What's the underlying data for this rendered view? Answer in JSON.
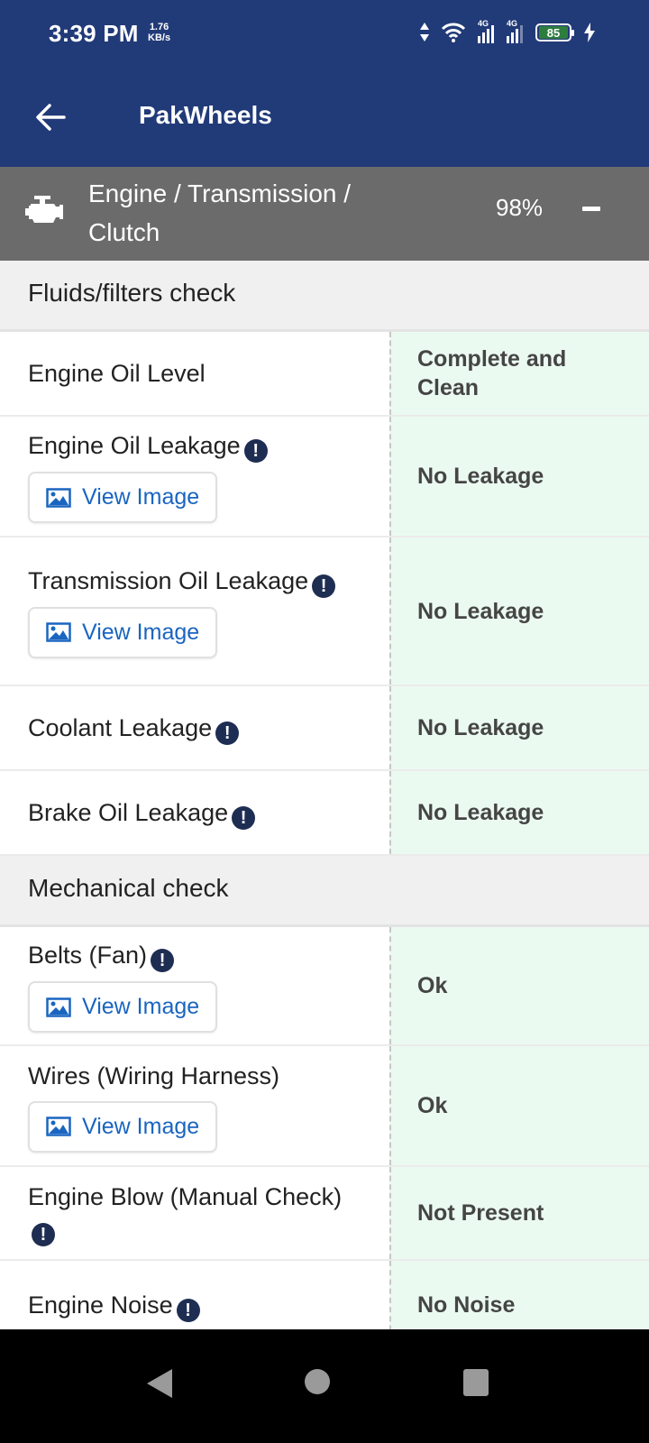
{
  "status_bar": {
    "time": "3:39 PM",
    "net_speed_value": "1.76",
    "net_speed_unit": "KB/s",
    "signal_1_label": "4G",
    "signal_2_label": "4G",
    "battery": "85",
    "icons": [
      "data-arrows-icon",
      "wifi-icon",
      "signal-icon",
      "signal-icon",
      "battery-icon",
      "charging-icon"
    ]
  },
  "app_bar": {
    "title": "PakWheels",
    "back_icon": "arrow-left-icon"
  },
  "section": {
    "icon": "engine-icon",
    "title": "Engine / Transmission / Clutch",
    "score": "98%",
    "toggle_icon": "minus-icon"
  },
  "groups": [
    {
      "title": "Fluids/filters check",
      "items": [
        {
          "label": "Engine Oil Level",
          "info": false,
          "view_image": false,
          "value": "Complete and Clean"
        },
        {
          "label": "Engine Oil Leakage",
          "info": true,
          "view_image": true,
          "value": "No Leakage"
        },
        {
          "label": "Transmission Oil Leakage",
          "info": true,
          "view_image": true,
          "value": "No Leakage"
        },
        {
          "label": "Coolant Leakage",
          "info": true,
          "view_image": false,
          "value": "No Leakage"
        },
        {
          "label": "Brake Oil Leakage",
          "info": true,
          "view_image": false,
          "value": "No Leakage"
        }
      ]
    },
    {
      "title": "Mechanical check",
      "items": [
        {
          "label": "Belts (Fan)",
          "info": true,
          "view_image": true,
          "value": "Ok"
        },
        {
          "label": "Wires (Wiring Harness)",
          "info": false,
          "view_image": true,
          "value": "Ok"
        },
        {
          "label": "Engine Blow (Manual Check)",
          "info": true,
          "view_image": false,
          "value": "Not Present"
        },
        {
          "label": "Engine Noise",
          "info": true,
          "view_image": false,
          "value": "No Noise"
        }
      ]
    }
  ],
  "view_image_label": "View Image",
  "info_glyph": "!",
  "colors": {
    "app_bar": "#213a78",
    "section_header": "#6b6b6b",
    "group_header": "#f0f0f0",
    "value_bg": "#ebfaf1",
    "link_blue": "#1a65c0",
    "info_icon": "#1e2d52"
  },
  "nav_bar": {
    "buttons": [
      "back-triangle-icon",
      "home-circle-icon",
      "recents-square-icon"
    ]
  }
}
